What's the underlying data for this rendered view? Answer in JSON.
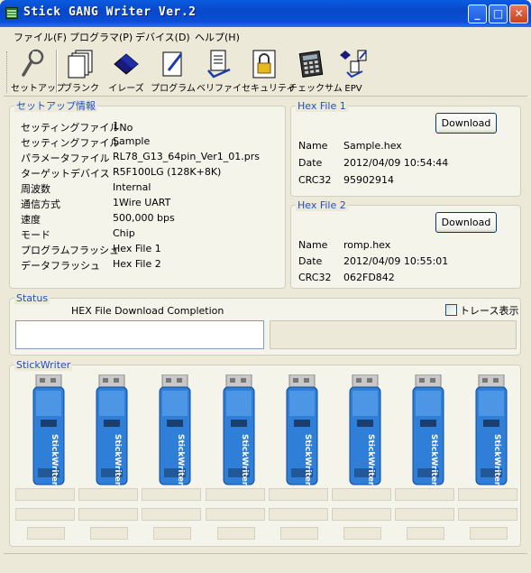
{
  "window": {
    "title": "Stick GANG Writer Ver.2",
    "minimize": "_",
    "maximize": "□",
    "close": "✕"
  },
  "menu": [
    {
      "label": "ファイル(F)"
    },
    {
      "label": "プログラマ(P)"
    },
    {
      "label": "デバイス(D)"
    },
    {
      "label": "ヘルプ(H)"
    }
  ],
  "toolbar": {
    "setup": "セットアップ",
    "blank": "ブランク",
    "erase": "イレーズ",
    "program": "プログラム",
    "verify": "ベリファイ",
    "security": "セキュリティ",
    "checksum": "チェックサム",
    "epv": "EPV"
  },
  "setup_info": {
    "title": "セットアップ情報",
    "rows": [
      {
        "key": "セッティングファイルNo",
        "value": "1"
      },
      {
        "key": "セッティングファイル",
        "value": "Sample"
      },
      {
        "key": "パラメータファイル",
        "value": "RL78_G13_64pin_Ver1_01.prs"
      },
      {
        "key": "ターゲットデバイス",
        "value": "R5F100LG (128K+8K)"
      },
      {
        "key": "周波数",
        "value": "Internal"
      },
      {
        "key": "通信方式",
        "value": "1Wire UART"
      },
      {
        "key": "速度",
        "value": "500,000 bps"
      },
      {
        "key": "モード",
        "value": "Chip"
      },
      {
        "key": "プログラムフラッシュ",
        "value": "Hex File 1"
      },
      {
        "key": "データフラッシュ",
        "value": "Hex File 2"
      }
    ]
  },
  "hex1": {
    "title": "Hex File 1",
    "button": "Download",
    "name_label": "Name",
    "name": "Sample.hex",
    "date_label": "Date",
    "date": "2012/04/09 10:54:44",
    "crc_label": "CRC32",
    "crc": "95902914"
  },
  "hex2": {
    "title": "Hex File 2",
    "button": "Download",
    "name_label": "Name",
    "name": "romp.hex",
    "date_label": "Date",
    "date": "2012/04/09 10:55:01",
    "crc_label": "CRC32",
    "crc": "062FD842"
  },
  "status": {
    "title": "Status",
    "message": "HEX File Download Completion",
    "trace_label": "トレース表示",
    "trace_checked": false
  },
  "stickwriter": {
    "title": "StickWriter",
    "device_label": "StickWriter",
    "count": 8
  },
  "colors": {
    "titlebar": "#0a4fd6",
    "group_title": "#1f4fc2",
    "window_bg": "#ece9d8",
    "stick_blue": "#2f7fd8"
  }
}
